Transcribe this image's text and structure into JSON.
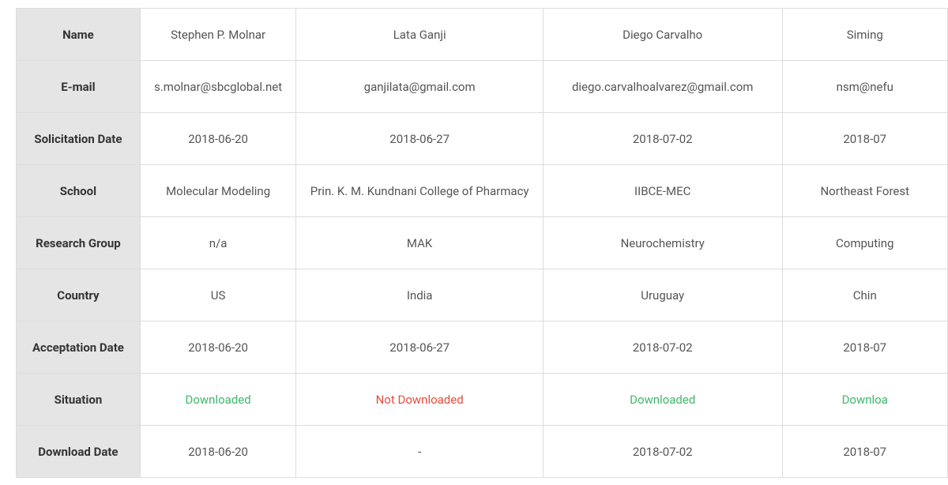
{
  "headers": {
    "name": "Name",
    "email": "E-mail",
    "solicitation_date": "Solicitation Date",
    "school": "School",
    "research_group": "Research Group",
    "country": "Country",
    "acceptation_date": "Acceptation Date",
    "situation": "Situation",
    "download_date": "Download Date"
  },
  "rows": [
    {
      "name": "Stephen P. Molnar",
      "email": "s.molnar@sbcglobal.net",
      "solicitation_date": "2018-06-20",
      "school": "Molecular Modeling",
      "research_group": "n/a",
      "country": "US",
      "acceptation_date": "2018-06-20",
      "situation": "Downloaded",
      "situation_class": "sit-downloaded",
      "download_date": "2018-06-20"
    },
    {
      "name": "Lata Ganji",
      "email": "ganjilata@gmail.com",
      "solicitation_date": "2018-06-27",
      "school": "Prin. K. M. Kundnani College of Pharmacy",
      "research_group": "MAK",
      "country": "India",
      "acceptation_date": "2018-06-27",
      "situation": "Not Downloaded",
      "situation_class": "sit-notdownloaded",
      "download_date": "-"
    },
    {
      "name": "Diego Carvalho",
      "email": "diego.carvalhoalvarez@gmail.com",
      "solicitation_date": "2018-07-02",
      "school": "IIBCE-MEC",
      "research_group": "Neurochemistry",
      "country": "Uruguay",
      "acceptation_date": "2018-07-02",
      "situation": "Downloaded",
      "situation_class": "sit-downloaded",
      "download_date": "2018-07-02"
    },
    {
      "name": "Siming",
      "email": "nsm@nefu",
      "solicitation_date": "2018-07",
      "school": "Northeast Forest",
      "research_group": "Computing",
      "country": "Chin",
      "acceptation_date": "2018-07",
      "situation": "Downloa",
      "situation_class": "sit-downloaded",
      "download_date": "2018-07"
    }
  ]
}
